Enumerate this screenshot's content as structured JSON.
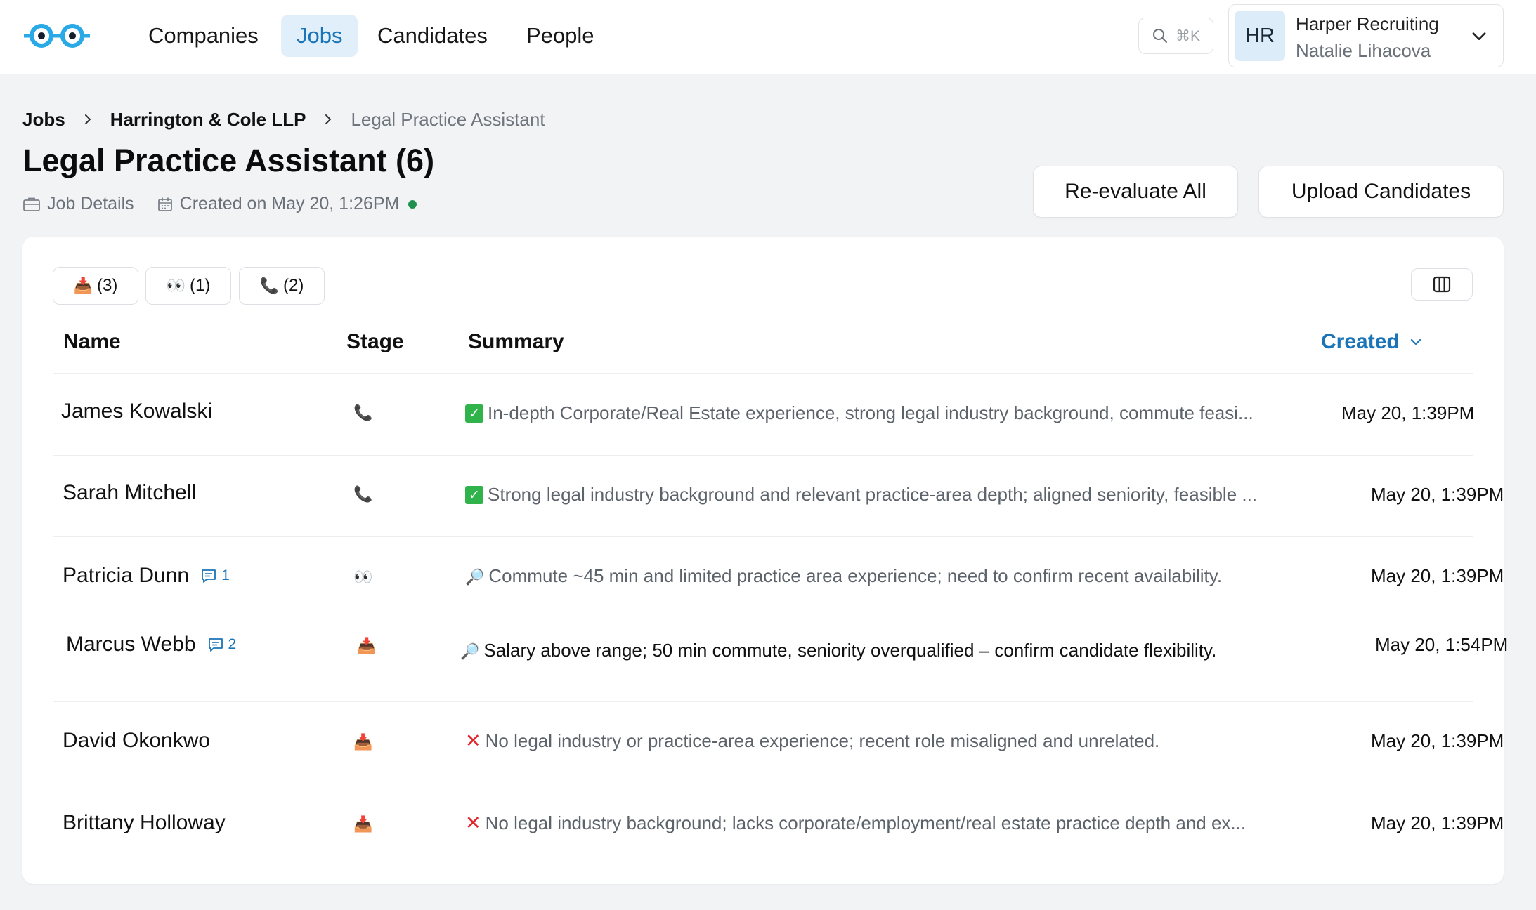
{
  "nav": {
    "items": [
      {
        "label": "Companies",
        "active": false
      },
      {
        "label": "Jobs",
        "active": true
      },
      {
        "label": "Candidates",
        "active": false
      },
      {
        "label": "People",
        "active": false
      }
    ],
    "search_shortcut": "⌘K"
  },
  "account": {
    "initials": "HR",
    "org": "Harper Recruiting",
    "user": "Natalie Lihacova"
  },
  "breadcrumb": {
    "root": "Jobs",
    "company": "Harrington & Cole LLP",
    "current": "Legal Practice Assistant"
  },
  "page": {
    "title": "Legal Practice Assistant (6)",
    "job_details_label": "Job Details",
    "created_label": "Created on May 20, 1:26PM",
    "status_color": "#1f8f4e"
  },
  "actions": {
    "reevaluate_label": "Re-evaluate All",
    "upload_label": "Upload Candidates"
  },
  "filters": [
    {
      "icon": "inbox-tray",
      "glyph": "📥",
      "count": "(3)"
    },
    {
      "icon": "eyes",
      "glyph": "👀",
      "count": "(1)"
    },
    {
      "icon": "telephone",
      "glyph": "📞",
      "count": "(2)"
    }
  ],
  "table": {
    "headers": {
      "name": "Name",
      "stage": "Stage",
      "summary": "Summary",
      "created": "Created"
    },
    "sort": {
      "column": "created",
      "direction": "desc"
    },
    "rows": [
      {
        "name": "James Kowalski",
        "comments": "",
        "stage": "📞",
        "stage_icon": "telephone",
        "summary_icon": "✓",
        "summary_kind": "positive",
        "summary": "In-depth Corporate/Real Estate experience, strong legal industry background, commute feasi...",
        "created": "May 20, 1:39PM"
      },
      {
        "name": "Sarah Mitchell",
        "comments": "",
        "stage": "📞",
        "stage_icon": "telephone",
        "summary_icon": "✓",
        "summary_kind": "positive",
        "summary": "Strong legal industry background and relevant practice-area depth; aligned seniority, feasible ...",
        "created": "May 20, 1:39PM"
      },
      {
        "name": "Patricia Dunn",
        "comments": "1",
        "stage": "👀",
        "stage_icon": "eyes",
        "summary_icon": "🔎",
        "summary_kind": "review",
        "summary": "Commute ~45 min and limited practice area experience; need to confirm recent availability.",
        "created": "May 20, 1:39PM"
      },
      {
        "name": "Marcus Webb",
        "comments": "2",
        "stage": "📥",
        "stage_icon": "inbox-tray",
        "summary_icon": "🔎",
        "summary_kind": "review-highlight",
        "summary": "Salary above range; 50 min commute, seniority overqualified – confirm candidate flexibility.",
        "created": "May 20, 1:54PM"
      },
      {
        "name": "David Okonkwo",
        "comments": "",
        "stage": "📥",
        "stage_icon": "inbox-tray",
        "summary_icon": "✕",
        "summary_kind": "negative",
        "summary": "No legal industry or practice-area experience; recent role misaligned and unrelated.",
        "created": "May 20, 1:39PM"
      },
      {
        "name": "Brittany Holloway",
        "comments": "",
        "stage": "📥",
        "stage_icon": "inbox-tray",
        "summary_icon": "✕",
        "summary_kind": "negative",
        "summary": "No legal industry background; lacks corporate/employment/real estate practice depth and ex...",
        "created": "May 20, 1:39PM"
      }
    ]
  },
  "colors": {
    "accent": "#1a74b8",
    "nav_active_bg": "#e0effa",
    "positive": "#2fb34a",
    "negative": "#e0242a"
  }
}
